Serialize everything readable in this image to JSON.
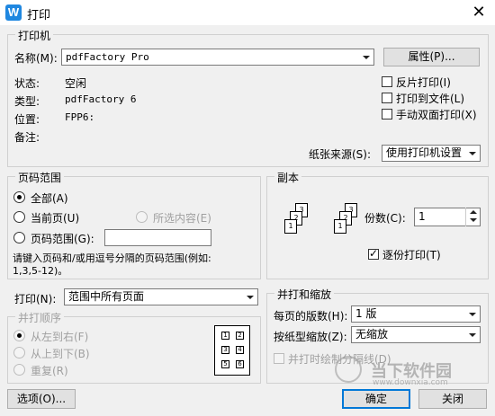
{
  "window": {
    "title": "打印",
    "app_icon": "W",
    "close": "✕"
  },
  "printer": {
    "group": "打印机",
    "name_label": "名称(M):",
    "name_value": "pdfFactory Pro",
    "properties_btn": "属性(P)...",
    "status_label": "状态:",
    "status_value": "空闲",
    "type_label": "类型:",
    "type_value": "pdfFactory 6",
    "where_label": "位置:",
    "where_value": "FPP6:",
    "comment_label": "备注:",
    "reverse": "反片打印(I)",
    "to_file": "打印到文件(L)",
    "duplex": "手动双面打印(X)",
    "source_label": "纸张来源(S):",
    "source_value": "使用打印机设置"
  },
  "range": {
    "group": "页码范围",
    "all": "全部(A)",
    "current": "当前页(U)",
    "selection": "所选内容(E)",
    "pages": "页码范围(G):",
    "hint": "请键入页码和/或用逗号分隔的页码范围(例如:",
    "hint2": "1,3,5-12)。"
  },
  "copies": {
    "group": "副本",
    "count_label": "份数(C):",
    "count_value": "1",
    "collate": "逐份打印(T)"
  },
  "print_what": {
    "label": "打印(N):",
    "value": "范围中所有页面"
  },
  "order": {
    "group": "并打顺序",
    "ltr": "从左到右(F)",
    "ttb": "从上到下(B)",
    "repeat": "重复(R)",
    "cells": [
      "1",
      "2",
      "3",
      "4",
      "5",
      "6"
    ]
  },
  "zoom": {
    "group": "并打和缩放",
    "pps_label": "每页的版数(H):",
    "pps_value": "1 版",
    "scale_label": "按纸型缩放(Z):",
    "scale_value": "无缩放",
    "border": "并打时绘制分隔线(D)"
  },
  "footer": {
    "options": "选项(O)...",
    "ok": "确定",
    "cancel": "关闭"
  },
  "watermark": {
    "title": "当下软件园",
    "url": "www.downxia.com"
  }
}
